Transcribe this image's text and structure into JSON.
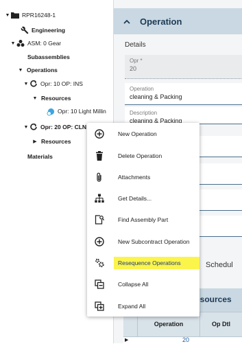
{
  "tree": {
    "root": "RPR16248-1",
    "engineering": "Engineering",
    "asm": "ASM: 0 Gear",
    "subassemblies": "Subassemblies",
    "operations": "Operations",
    "op10": "Opr: 10 OP: INS",
    "resources1": "Resources",
    "op10_resource": "Opr: 10 Light Millin",
    "op20": "Opr: 20 OP: CLN",
    "resources2": "Resources",
    "materials": "Materials"
  },
  "panel": {
    "title": "Operation",
    "section": "Details",
    "fields": [
      {
        "label": "Opr *",
        "value": "20"
      },
      {
        "label": "Operation",
        "value": "cleaning & Packing"
      },
      {
        "label": "Description",
        "value": "cleaning & Packing"
      }
    ],
    "tab_partial": "Schedul",
    "resources_partial": "esources",
    "grid_headers": [
      "Operation",
      "Op Dtl"
    ],
    "grid_row_value": "20"
  },
  "menu": {
    "items": [
      {
        "label": "New Operation",
        "icon": "plus-circle-icon"
      },
      {
        "label": "Delete Operation",
        "icon": "trash-icon"
      },
      {
        "label": "Attachments",
        "icon": "paperclip-icon"
      },
      {
        "label": "Get Details...",
        "icon": "hierarchy-icon"
      },
      {
        "label": "Find Assembly Part",
        "icon": "find-part-icon"
      },
      {
        "label": "New Subcontract Operation",
        "icon": "plus-circle-icon"
      },
      {
        "label": "Resequence Operations",
        "icon": "gears-icon",
        "highlighted": true
      },
      {
        "label": "Collapse All",
        "icon": "collapse-icon"
      },
      {
        "label": "Expand All",
        "icon": "expand-icon"
      }
    ]
  },
  "colors": {
    "header_bg": "#c9d8e2",
    "header_text": "#1d3a55",
    "highlight": "#fbf44a",
    "link": "#1e5ea8"
  }
}
